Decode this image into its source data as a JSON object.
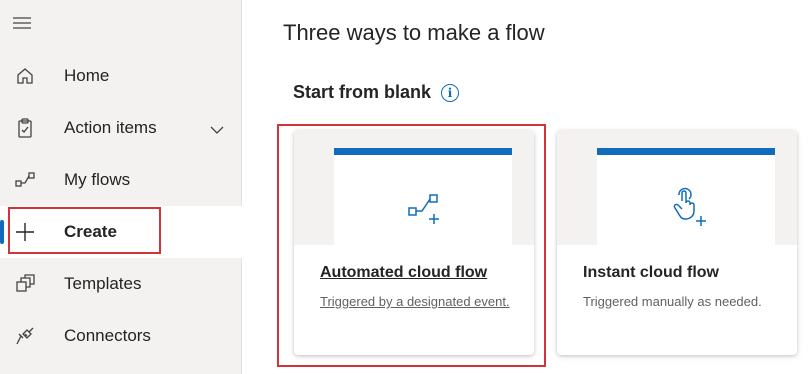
{
  "sidebar": {
    "items": [
      {
        "label": "Home",
        "icon": "home-icon"
      },
      {
        "label": "Action items",
        "icon": "clipboard-icon",
        "has_submenu": true
      },
      {
        "label": "My flows",
        "icon": "flow-icon"
      },
      {
        "label": "Create",
        "icon": "plus-icon",
        "active": true
      },
      {
        "label": "Templates",
        "icon": "templates-icon"
      },
      {
        "label": "Connectors",
        "icon": "connector-icon"
      }
    ]
  },
  "main": {
    "title": "Three ways to make a flow",
    "section_title": "Start from blank",
    "info_glyph": "i",
    "cards": [
      {
        "title": "Automated cloud flow",
        "description": "Triggered by a designated event.",
        "icon": "automated-flow-icon"
      },
      {
        "title": "Instant cloud flow",
        "description": "Triggered manually as needed.",
        "icon": "touch-icon"
      }
    ]
  },
  "colors": {
    "accent": "#0f6cbd",
    "highlight": "#d13438",
    "sidebar_bg": "#f3f2f1"
  }
}
